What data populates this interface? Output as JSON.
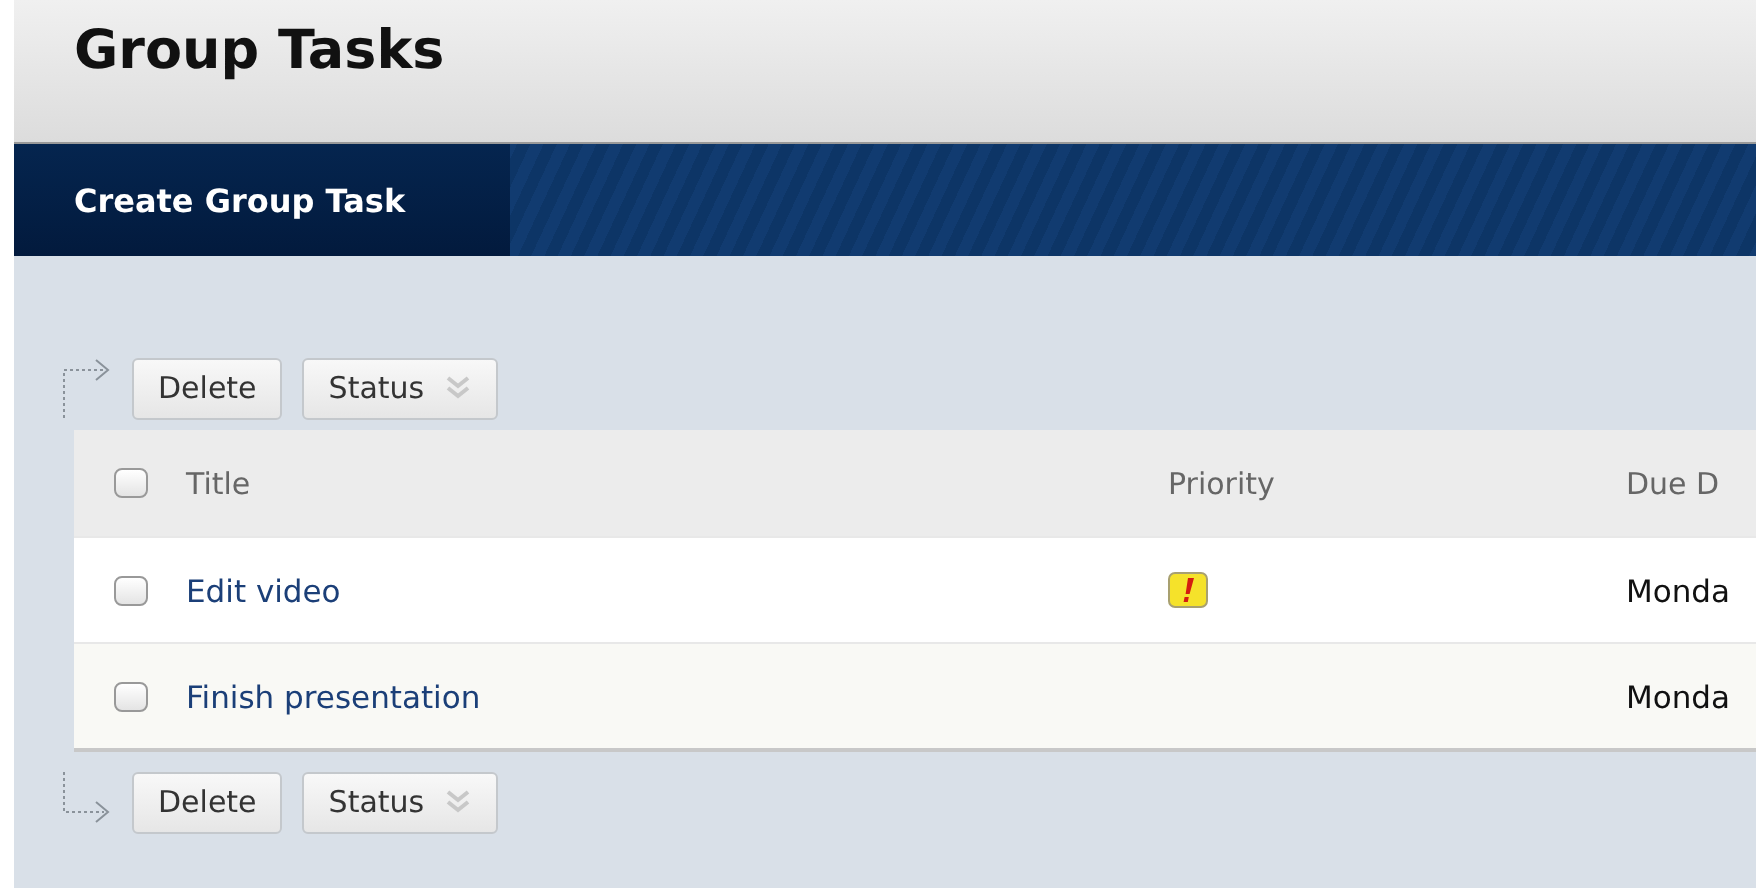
{
  "page_title": "Group Tasks",
  "nav_tabs": [
    {
      "label": "Create Group Task",
      "selected": true
    }
  ],
  "toolbars": [
    {
      "kind": "top",
      "buttons": [
        {
          "label": "Delete",
          "kind": "plain"
        },
        {
          "label": "Status",
          "kind": "menu"
        }
      ]
    },
    {
      "kind": "bottom",
      "buttons": [
        {
          "label": "Delete",
          "kind": "plain"
        },
        {
          "label": "Status",
          "kind": "menu"
        }
      ]
    }
  ],
  "table": {
    "select_all": {
      "checked": false
    },
    "columns": [
      "Title",
      "Priority",
      "Due D"
    ],
    "rows": [
      {
        "checked": false,
        "title": "Edit video",
        "high_priority": true,
        "due": "Monda"
      },
      {
        "checked": false,
        "title": "Finish presentation",
        "high_priority": false,
        "due": "Monda"
      }
    ]
  }
}
